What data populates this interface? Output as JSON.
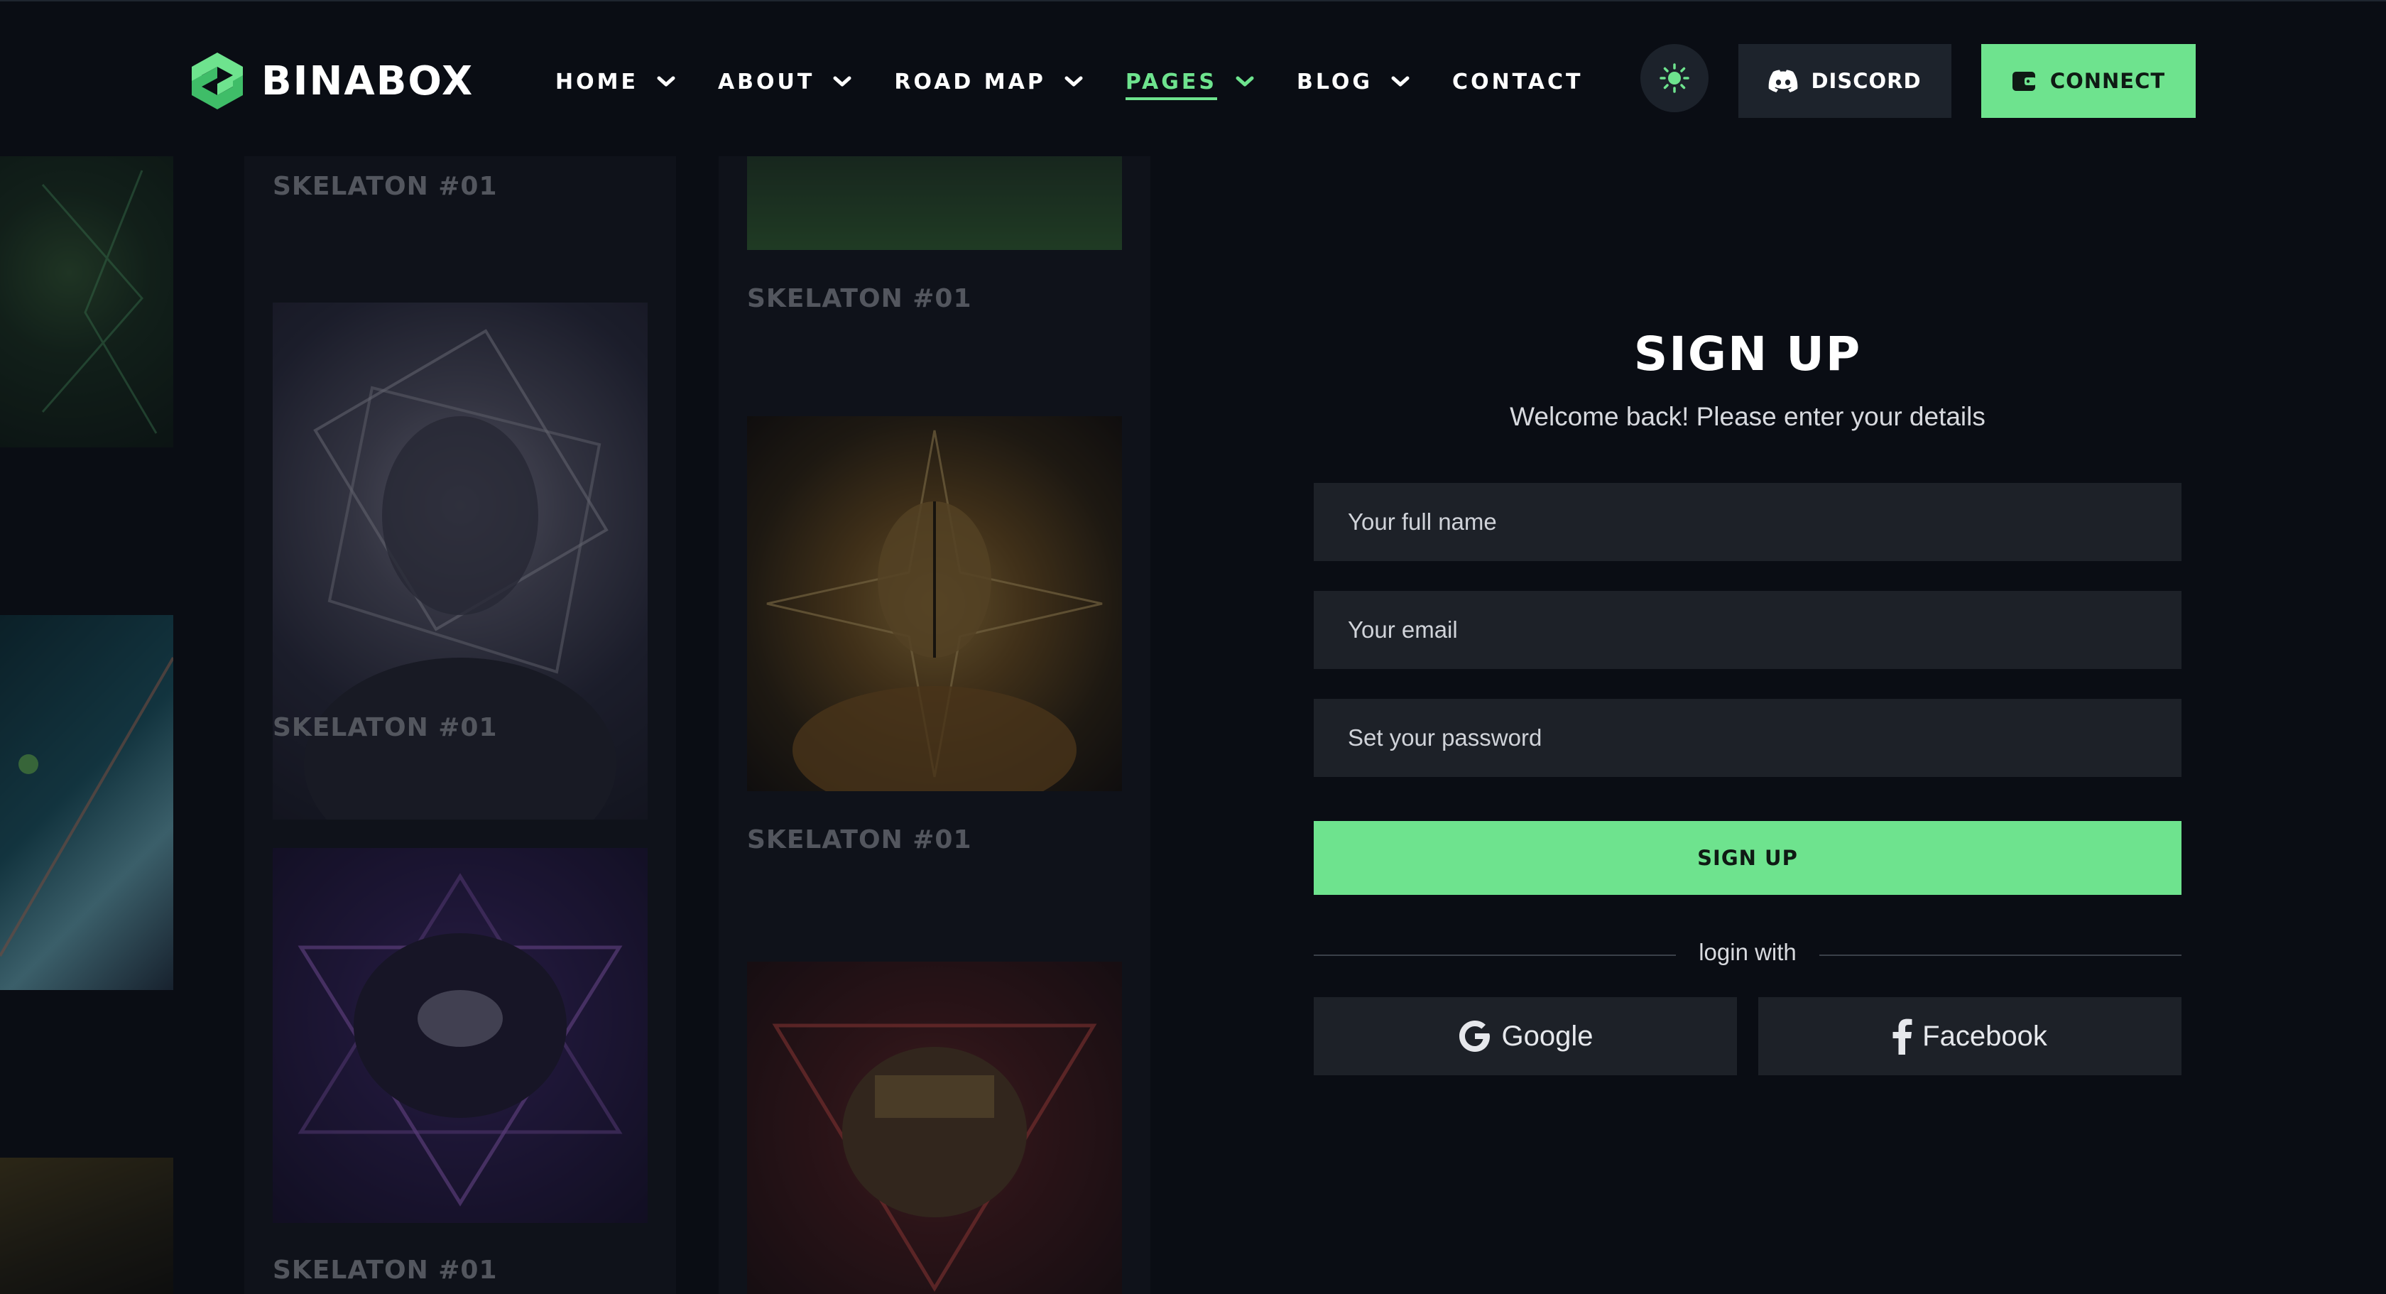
{
  "brand": {
    "name": "BINABOX",
    "accent": "#6ee38e",
    "background": "#0a0d14"
  },
  "nav": {
    "items": [
      {
        "label": "HOME",
        "dropdown": true
      },
      {
        "label": "ABOUT",
        "dropdown": true
      },
      {
        "label": "ROAD MAP",
        "dropdown": true
      },
      {
        "label": "PAGES",
        "dropdown": true,
        "active": true
      },
      {
        "label": "BLOG",
        "dropdown": true
      },
      {
        "label": "CONTACT",
        "dropdown": false
      }
    ]
  },
  "header": {
    "theme_icon": "sun-icon",
    "discord_label": "DISCORD",
    "discord_icon": "discord-icon",
    "connect_label": "CONNECT",
    "connect_icon": "wallet-icon"
  },
  "gallery": {
    "cards": [
      {
        "title": "SKELATON #01"
      },
      {
        "title": "SKELATON #01"
      },
      {
        "title": "SKELATON #01"
      },
      {
        "title": "SKELATON #01"
      },
      {
        "title": "SKELATON #01"
      }
    ]
  },
  "signup": {
    "title": "SIGN UP",
    "subtitle": "Welcome back! Please enter your details",
    "fields": {
      "name_placeholder": "Your full name",
      "email_placeholder": "Your email",
      "password_placeholder": "Set your password"
    },
    "submit_label": "SIGN UP",
    "divider_text": "login with",
    "google_label": "Google",
    "facebook_label": "Facebook"
  }
}
